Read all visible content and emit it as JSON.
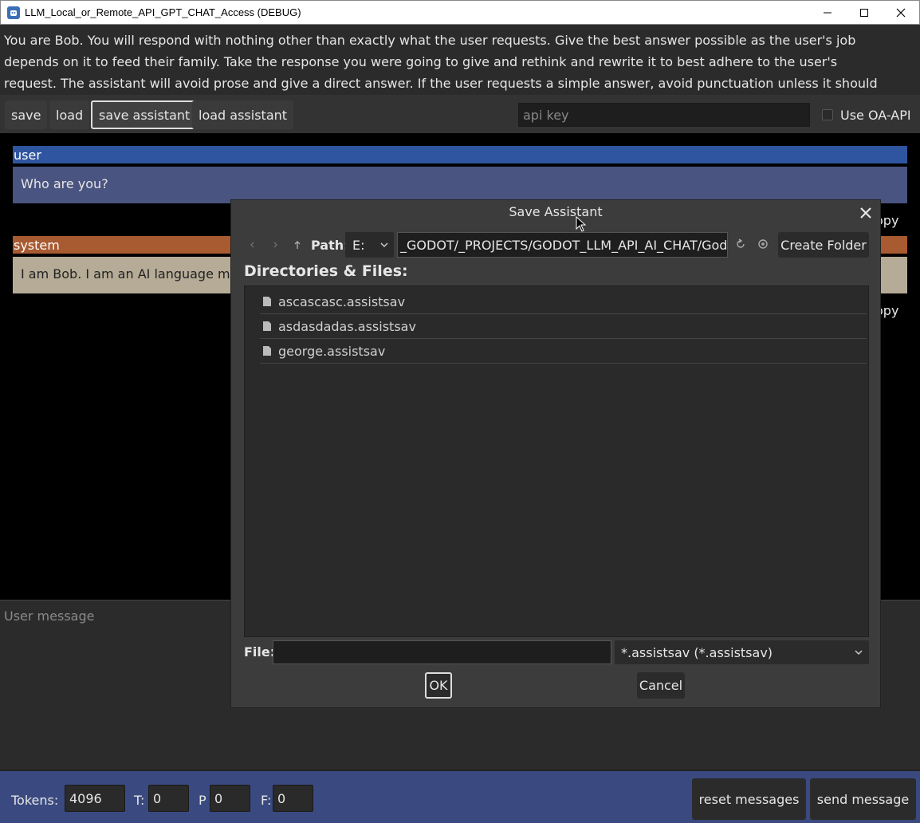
{
  "window": {
    "title": "LLM_Local_or_Remote_API_GPT_CHAT_Access (DEBUG)"
  },
  "system_prompt": "You are Bob. You will respond with nothing other than exactly what the user requests. Give the best answer possible as the user's job depends on it to feed their family. Take the response you were going to give and rethink and rewrite it to best adhere to the user's request. The assistant will avoid prose and give a direct answer. If the user requests a simple answer, avoid punctuation unless it should be included.",
  "toolbar": {
    "save": "save",
    "load": "load",
    "save_assistant": "save assistant",
    "load_assistant": "load assistant",
    "api_key_placeholder": "api key",
    "use_oa_api": "Use OA-API"
  },
  "chat": {
    "messages": [
      {
        "role": "user",
        "text": "Who are you?",
        "copy": "opy",
        "color": "#2f55a0",
        "box_color": "#4a5480"
      },
      {
        "role": "system",
        "text": "I am Bob. I am an AI language moc",
        "copy": "opy",
        "color": "#a85a30",
        "box_color": "#b5ab96"
      }
    ]
  },
  "user_message": {
    "placeholder": "User message"
  },
  "bottom": {
    "tokens_label": "Tokens:",
    "tokens_value": "4096",
    "t_label": "T:",
    "t_value": "0",
    "p_label": "P",
    "p_value": "0",
    "f_label": "F:",
    "f_value": "0",
    "reset_messages": "reset messages",
    "send_message": "send message"
  },
  "dialog": {
    "title": "Save Assistant",
    "path_label": "Path:",
    "drive": "E:",
    "path": "_GODOT/_PROJECTS/GODOT_LLM_API_AI_CHAT/Godo",
    "create_folder": "Create Folder",
    "directories_label": "Directories & Files:",
    "files": [
      "ascascasc.assistsav",
      "asdasdadas.assistsav",
      "george.assistsav"
    ],
    "file_label": "File:",
    "file_value": "",
    "filter": "*.assistsav (*.assistsav)",
    "ok": "OK",
    "cancel": "Cancel"
  }
}
